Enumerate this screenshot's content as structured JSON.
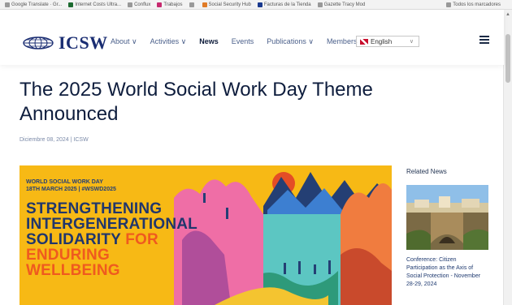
{
  "bookmarks": [
    "Google Translate · Gr...",
    "Internet Costs Ultra...",
    "Conflux",
    "Trabajos",
    "",
    "Social Security Hub",
    "Facturas de la Tienda",
    "Gazette Tracy Mod"
  ],
  "bookmarks_right": "Todos los marcadores",
  "header": {
    "logo_text": "ICSW",
    "nav": [
      {
        "label": "About",
        "caret": "∨"
      },
      {
        "label": "Activities",
        "caret": "∨"
      },
      {
        "label": "News",
        "caret": ""
      },
      {
        "label": "Events",
        "caret": ""
      },
      {
        "label": "Publications",
        "caret": "∨"
      },
      {
        "label": "Members",
        "caret": "∨"
      }
    ],
    "language": "English",
    "language_caret": "∨"
  },
  "article": {
    "title": "The 2025 World Social Work Day Theme Announced",
    "meta": "Diciembre 08, 2024 | ICSW",
    "hero": {
      "kicker_line1": "WORLD SOCIAL WORK DAY",
      "kicker_line2": "18TH MARCH 2025 | #WSWD2025",
      "line1": "STRENGTHENING",
      "line2": "INTERGENERATIONAL",
      "line3a": "SOLIDARITY ",
      "line3b": "FOR",
      "line4": "ENDURING",
      "line5": "WELLBEING"
    }
  },
  "sidebar": {
    "title": "Related News",
    "items": [
      {
        "caption": "Conference: Citizen Participation as the Axis of Social Protection - November 28-29, 2024"
      }
    ]
  },
  "colors": {
    "brand": "#1a2d72",
    "hero_bg": "#f7b915",
    "hero_blue": "#20366c",
    "hero_orange": "#ef5a1f"
  }
}
